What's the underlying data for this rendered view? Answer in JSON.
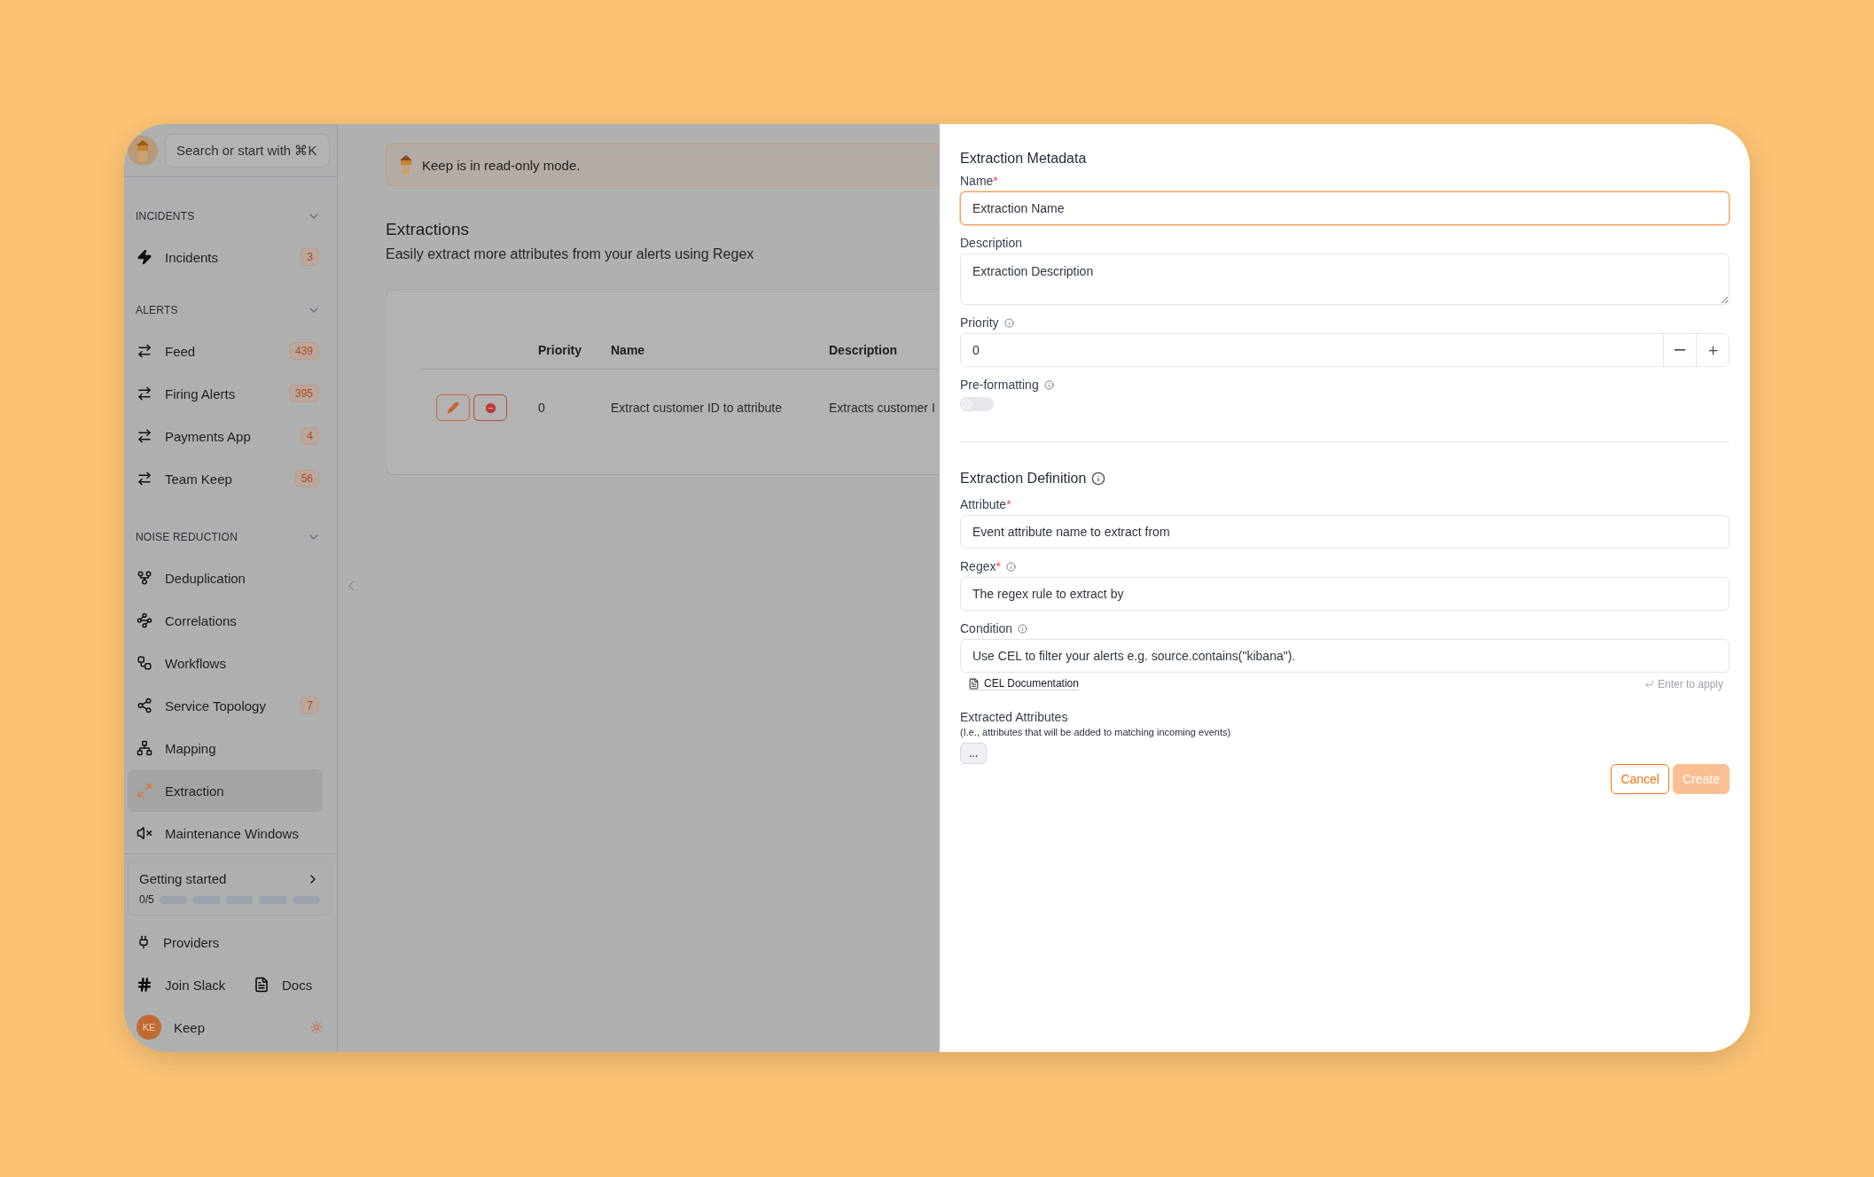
{
  "sidebar": {
    "search": {
      "placeholder": "Search or start with ⌘K"
    },
    "sections": [
      {
        "title": "INCIDENTS",
        "expanded": true,
        "items": [
          {
            "label": "Incidents",
            "badge": "3",
            "selected": false
          }
        ]
      },
      {
        "title": "ALERTS",
        "expanded": true,
        "items": [
          {
            "label": "Feed",
            "badge": "439",
            "selected": false
          },
          {
            "label": "Firing Alerts",
            "badge": "395",
            "selected": false
          },
          {
            "label": "Payments App",
            "badge": "4",
            "selected": false
          },
          {
            "label": "Team Keep",
            "badge": "56",
            "selected": false
          }
        ]
      },
      {
        "title": "NOISE REDUCTION",
        "expanded": true,
        "items": [
          {
            "label": "Deduplication",
            "selected": false
          },
          {
            "label": "Correlations",
            "selected": false
          },
          {
            "label": "Workflows",
            "selected": false
          },
          {
            "label": "Service Topology",
            "badge": "7",
            "selected": false
          },
          {
            "label": "Mapping",
            "selected": false
          },
          {
            "label": "Extraction",
            "selected": true
          },
          {
            "label": "Maintenance Windows",
            "selected": false
          }
        ]
      }
    ],
    "getting_started": {
      "title": "Getting started",
      "progress": "0/5",
      "steps": [
        {
          "done": false
        },
        {
          "done": false
        },
        {
          "done": false
        },
        {
          "done": false
        },
        {
          "done": false
        }
      ]
    },
    "providers": "Providers",
    "join_slack": "Join Slack",
    "docs": "Docs",
    "user": {
      "initials": "KE",
      "name": "Keep"
    }
  },
  "banner": "Keep is in read-only mode.",
  "page": {
    "title": "Extractions",
    "subtitle": "Easily extract more attributes from your alerts using Regex"
  },
  "table": {
    "columns": [
      "Priority",
      "Name",
      "Description"
    ],
    "rows": [
      {
        "priority": "0",
        "name": "Extract customer ID to attribute",
        "description": "Extracts customer I"
      }
    ]
  },
  "panel": {
    "metadata_title": "Extraction Metadata",
    "name": {
      "label": "Name",
      "required_mark": "*",
      "placeholder": "Extraction Name"
    },
    "description": {
      "label": "Description",
      "placeholder": "Extraction Description"
    },
    "priority": {
      "label": "Priority",
      "value": "0"
    },
    "preformatting": {
      "label": "Pre-formatting",
      "on": false
    },
    "definition_title": "Extraction Definition",
    "attribute": {
      "label": "Attribute",
      "required_mark": "*",
      "placeholder": "Event attribute name to extract from"
    },
    "regex": {
      "label": "Regex",
      "required_mark": "*",
      "placeholder": "The regex rule to extract by"
    },
    "condition": {
      "label": "Condition",
      "placeholder": "Use CEL to filter your alerts e.g. source.contains(\"kibana\")."
    },
    "cel_link": "CEL Documentation",
    "enter_hint": "Enter to apply",
    "extracted_title": "Extracted Attributes",
    "extracted_hint": "(I.e., attributes that will be added to matching incoming events)",
    "extracted_value": "...",
    "cancel": "Cancel",
    "create": {
      "label": "Create",
      "disabled": true
    }
  }
}
